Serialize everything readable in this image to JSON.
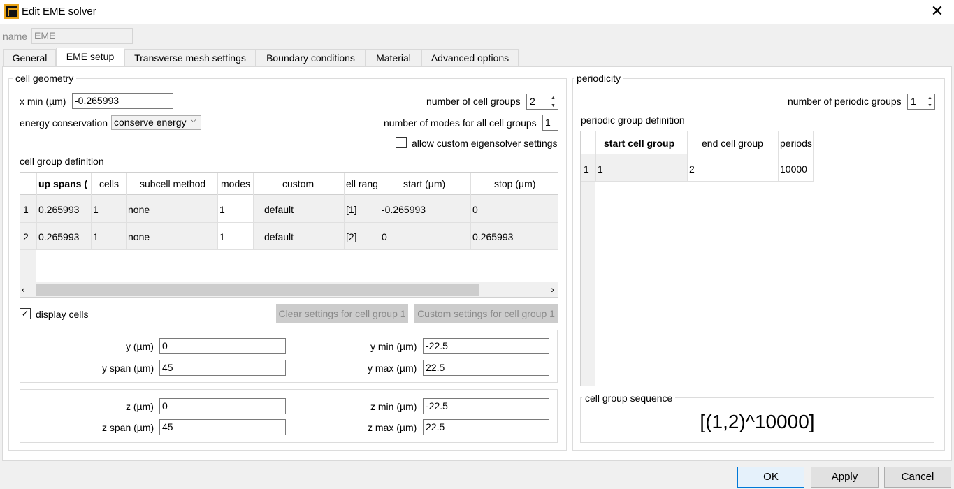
{
  "window": {
    "title": "Edit EME solver"
  },
  "name_field": {
    "label": "name",
    "value": "EME"
  },
  "tabs": [
    {
      "label": "General"
    },
    {
      "label": "EME setup"
    },
    {
      "label": "Transverse mesh settings"
    },
    {
      "label": "Boundary conditions"
    },
    {
      "label": "Material"
    },
    {
      "label": "Advanced options"
    }
  ],
  "cell_geometry": {
    "title": "cell geometry",
    "x_min": {
      "label": "x min (µm)",
      "value": "-0.265993"
    },
    "energy_conservation": {
      "label": "energy conservation",
      "value": "conserve energy"
    },
    "num_cell_groups": {
      "label": "number of cell groups",
      "value": "2"
    },
    "num_modes": {
      "label": "number of modes for all cell groups",
      "value": "1"
    },
    "allow_custom": {
      "label": "allow custom eigensolver settings"
    },
    "definition_title": "cell group definition",
    "columns": [
      "up spans (",
      "cells",
      "subcell method",
      "modes",
      "custom",
      "ell rang",
      "start (µm)",
      "stop (µm)"
    ],
    "rows": [
      {
        "index": "1",
        "cells": [
          "0.265993",
          "1",
          "none",
          "1",
          "default",
          "[1]",
          "-0.265993",
          "0"
        ]
      },
      {
        "index": "2",
        "cells": [
          "0.265993",
          "1",
          "none",
          "1",
          "default",
          "[2]",
          "0",
          "0.265993"
        ]
      }
    ],
    "display_cells": {
      "label": "display cells"
    },
    "clear_btn": "Clear settings for cell group 1",
    "custom_btn": "Custom settings for cell group 1"
  },
  "y_section": {
    "y": {
      "label": "y (µm)",
      "value": "0"
    },
    "y_span": {
      "label": "y span (µm)",
      "value": "45"
    },
    "y_min": {
      "label": "y min (µm)",
      "value": "-22.5"
    },
    "y_max": {
      "label": "y max (µm)",
      "value": "22.5"
    }
  },
  "z_section": {
    "z": {
      "label": "z (µm)",
      "value": "0"
    },
    "z_span": {
      "label": "z span (µm)",
      "value": "45"
    },
    "z_min": {
      "label": "z min (µm)",
      "value": "-22.5"
    },
    "z_max": {
      "label": "z max (µm)",
      "value": "22.5"
    }
  },
  "periodicity": {
    "title": "periodicity",
    "num_groups": {
      "label": "number of periodic groups",
      "value": "1"
    },
    "definition_title": "periodic group definition",
    "columns": [
      "start cell group",
      "end cell group",
      "periods"
    ],
    "rows": [
      {
        "index": "1",
        "cells": [
          "1",
          "2",
          "10000"
        ]
      }
    ],
    "sequence_title": "cell group sequence",
    "sequence_value": "[(1,2)^10000]"
  },
  "footer": {
    "ok": "OK",
    "apply": "Apply",
    "cancel": "Cancel"
  }
}
